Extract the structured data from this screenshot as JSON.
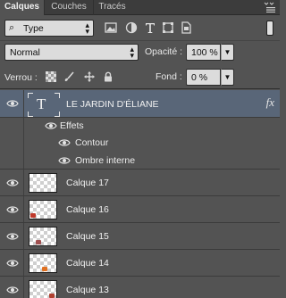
{
  "tabs": [
    {
      "label": "Calques"
    },
    {
      "label": "Couches"
    },
    {
      "label": "Tracés"
    }
  ],
  "filter": {
    "value": "Type"
  },
  "blend_mode": {
    "value": "Normal"
  },
  "opacity": {
    "label": "Opacité :",
    "value": "100 %"
  },
  "lock": {
    "label": "Verrou :"
  },
  "fill": {
    "label": "Fond :",
    "value": "0 %"
  },
  "text_layer": {
    "name": "LE JARDIN D'ÉLIANE",
    "fx_label": "fx",
    "effects_label": "Effets",
    "effects": [
      {
        "name": "Contour"
      },
      {
        "name": "Ombre interne"
      }
    ]
  },
  "layers": [
    {
      "name": "Calque 17",
      "blob_color": ""
    },
    {
      "name": "Calque 16",
      "blob_color": "#c0392b"
    },
    {
      "name": "Calque 15",
      "blob_color": "#a05050"
    },
    {
      "name": "Calque 14",
      "blob_color": "#e07020"
    },
    {
      "name": "Calque 13",
      "blob_color": "#b04030"
    }
  ],
  "colors": {
    "panel_bg": "#535353",
    "selected_row": "#596678",
    "tab_bar": "#3c3c3c"
  }
}
